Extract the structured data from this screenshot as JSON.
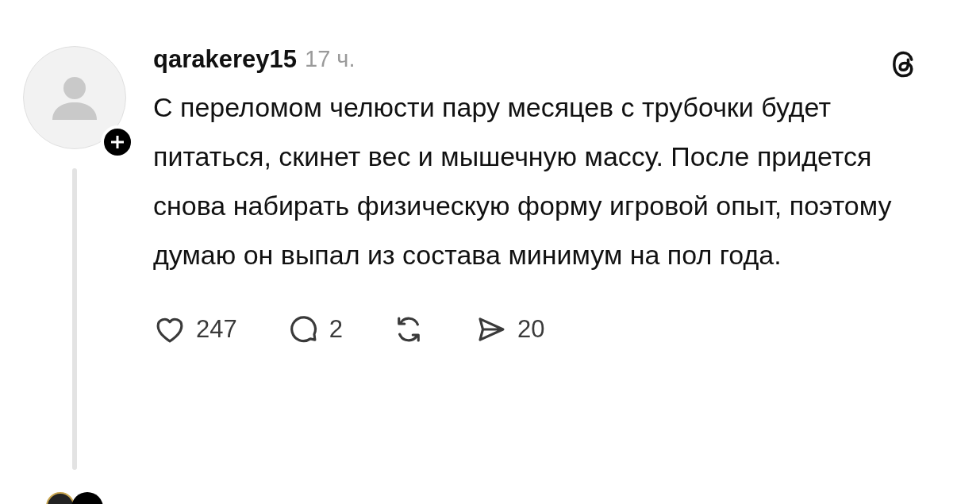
{
  "post": {
    "username": "qarakerey15",
    "time": "17 ч.",
    "text": "С переломом челюсти пару месяцев с трубочки будет питаться, скинет вес и мышечную массу. После придется снова набирать физическую форму игровой опыт, поэтому думаю он выпал из состава минимум на пол года.",
    "actions": [
      {
        "kind": "like",
        "count": "247"
      },
      {
        "kind": "reply",
        "count": "2"
      },
      {
        "kind": "repost"
      },
      {
        "kind": "share",
        "count": "20"
      }
    ]
  }
}
